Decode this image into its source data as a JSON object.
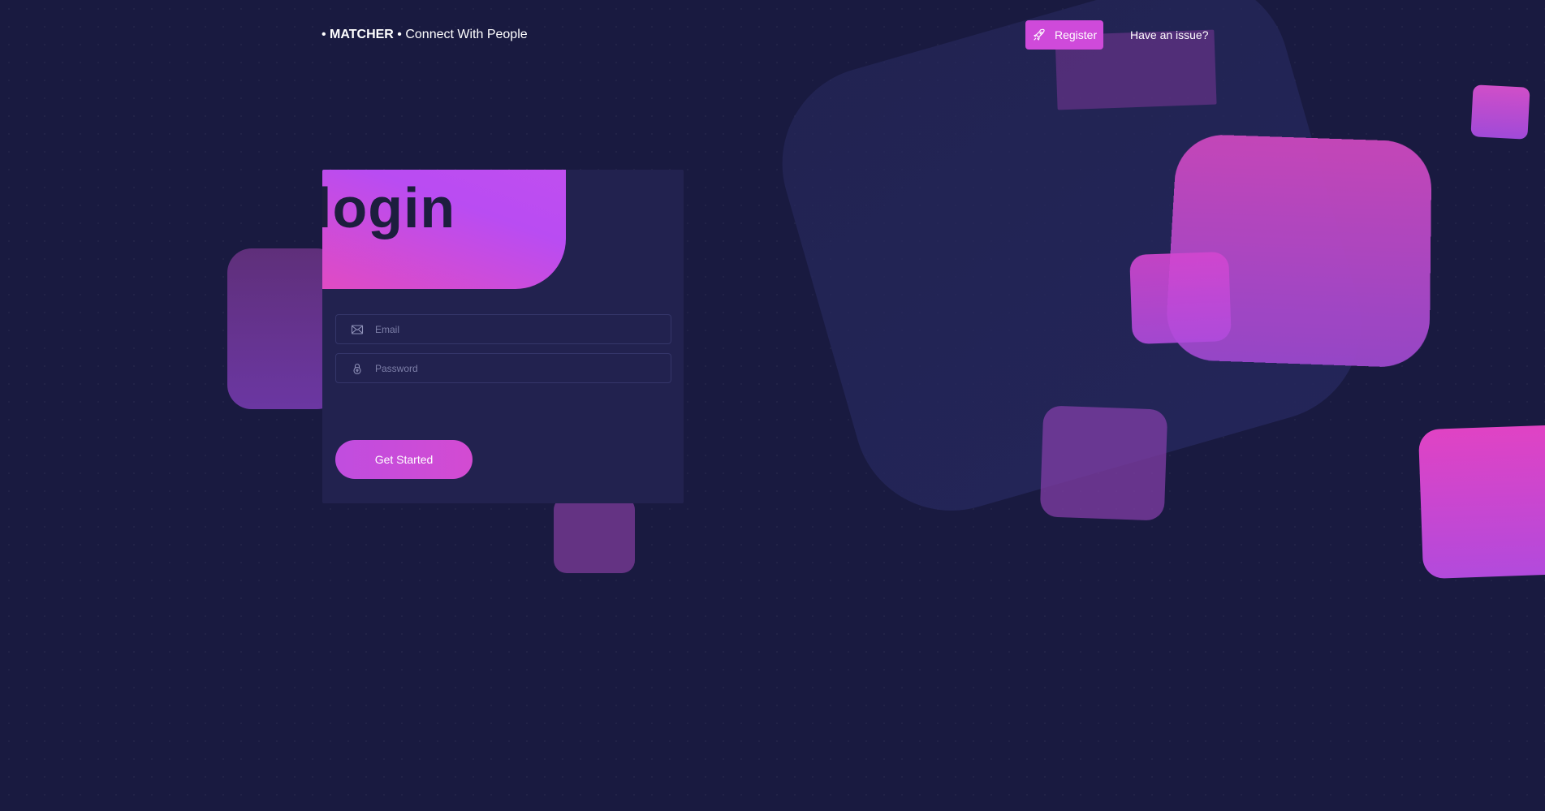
{
  "header": {
    "brand_prefix": "• ",
    "brand_name": "MATCHER",
    "brand_tagline": " • Connect With People",
    "register_label": "Register",
    "issue_link": "Have an issue?"
  },
  "login": {
    "title": "login",
    "email_placeholder": "Email",
    "password_placeholder": "Password",
    "submit_label": "Get Started"
  },
  "icons": {
    "register": "rocket-icon",
    "email": "envelope-icon",
    "password": "lock-icon"
  },
  "colors": {
    "background": "#191a40",
    "card": "#22224f",
    "accent": "#cf4ada",
    "accent_pink": "#e04bc3",
    "title_text": "#1d1e3e"
  }
}
